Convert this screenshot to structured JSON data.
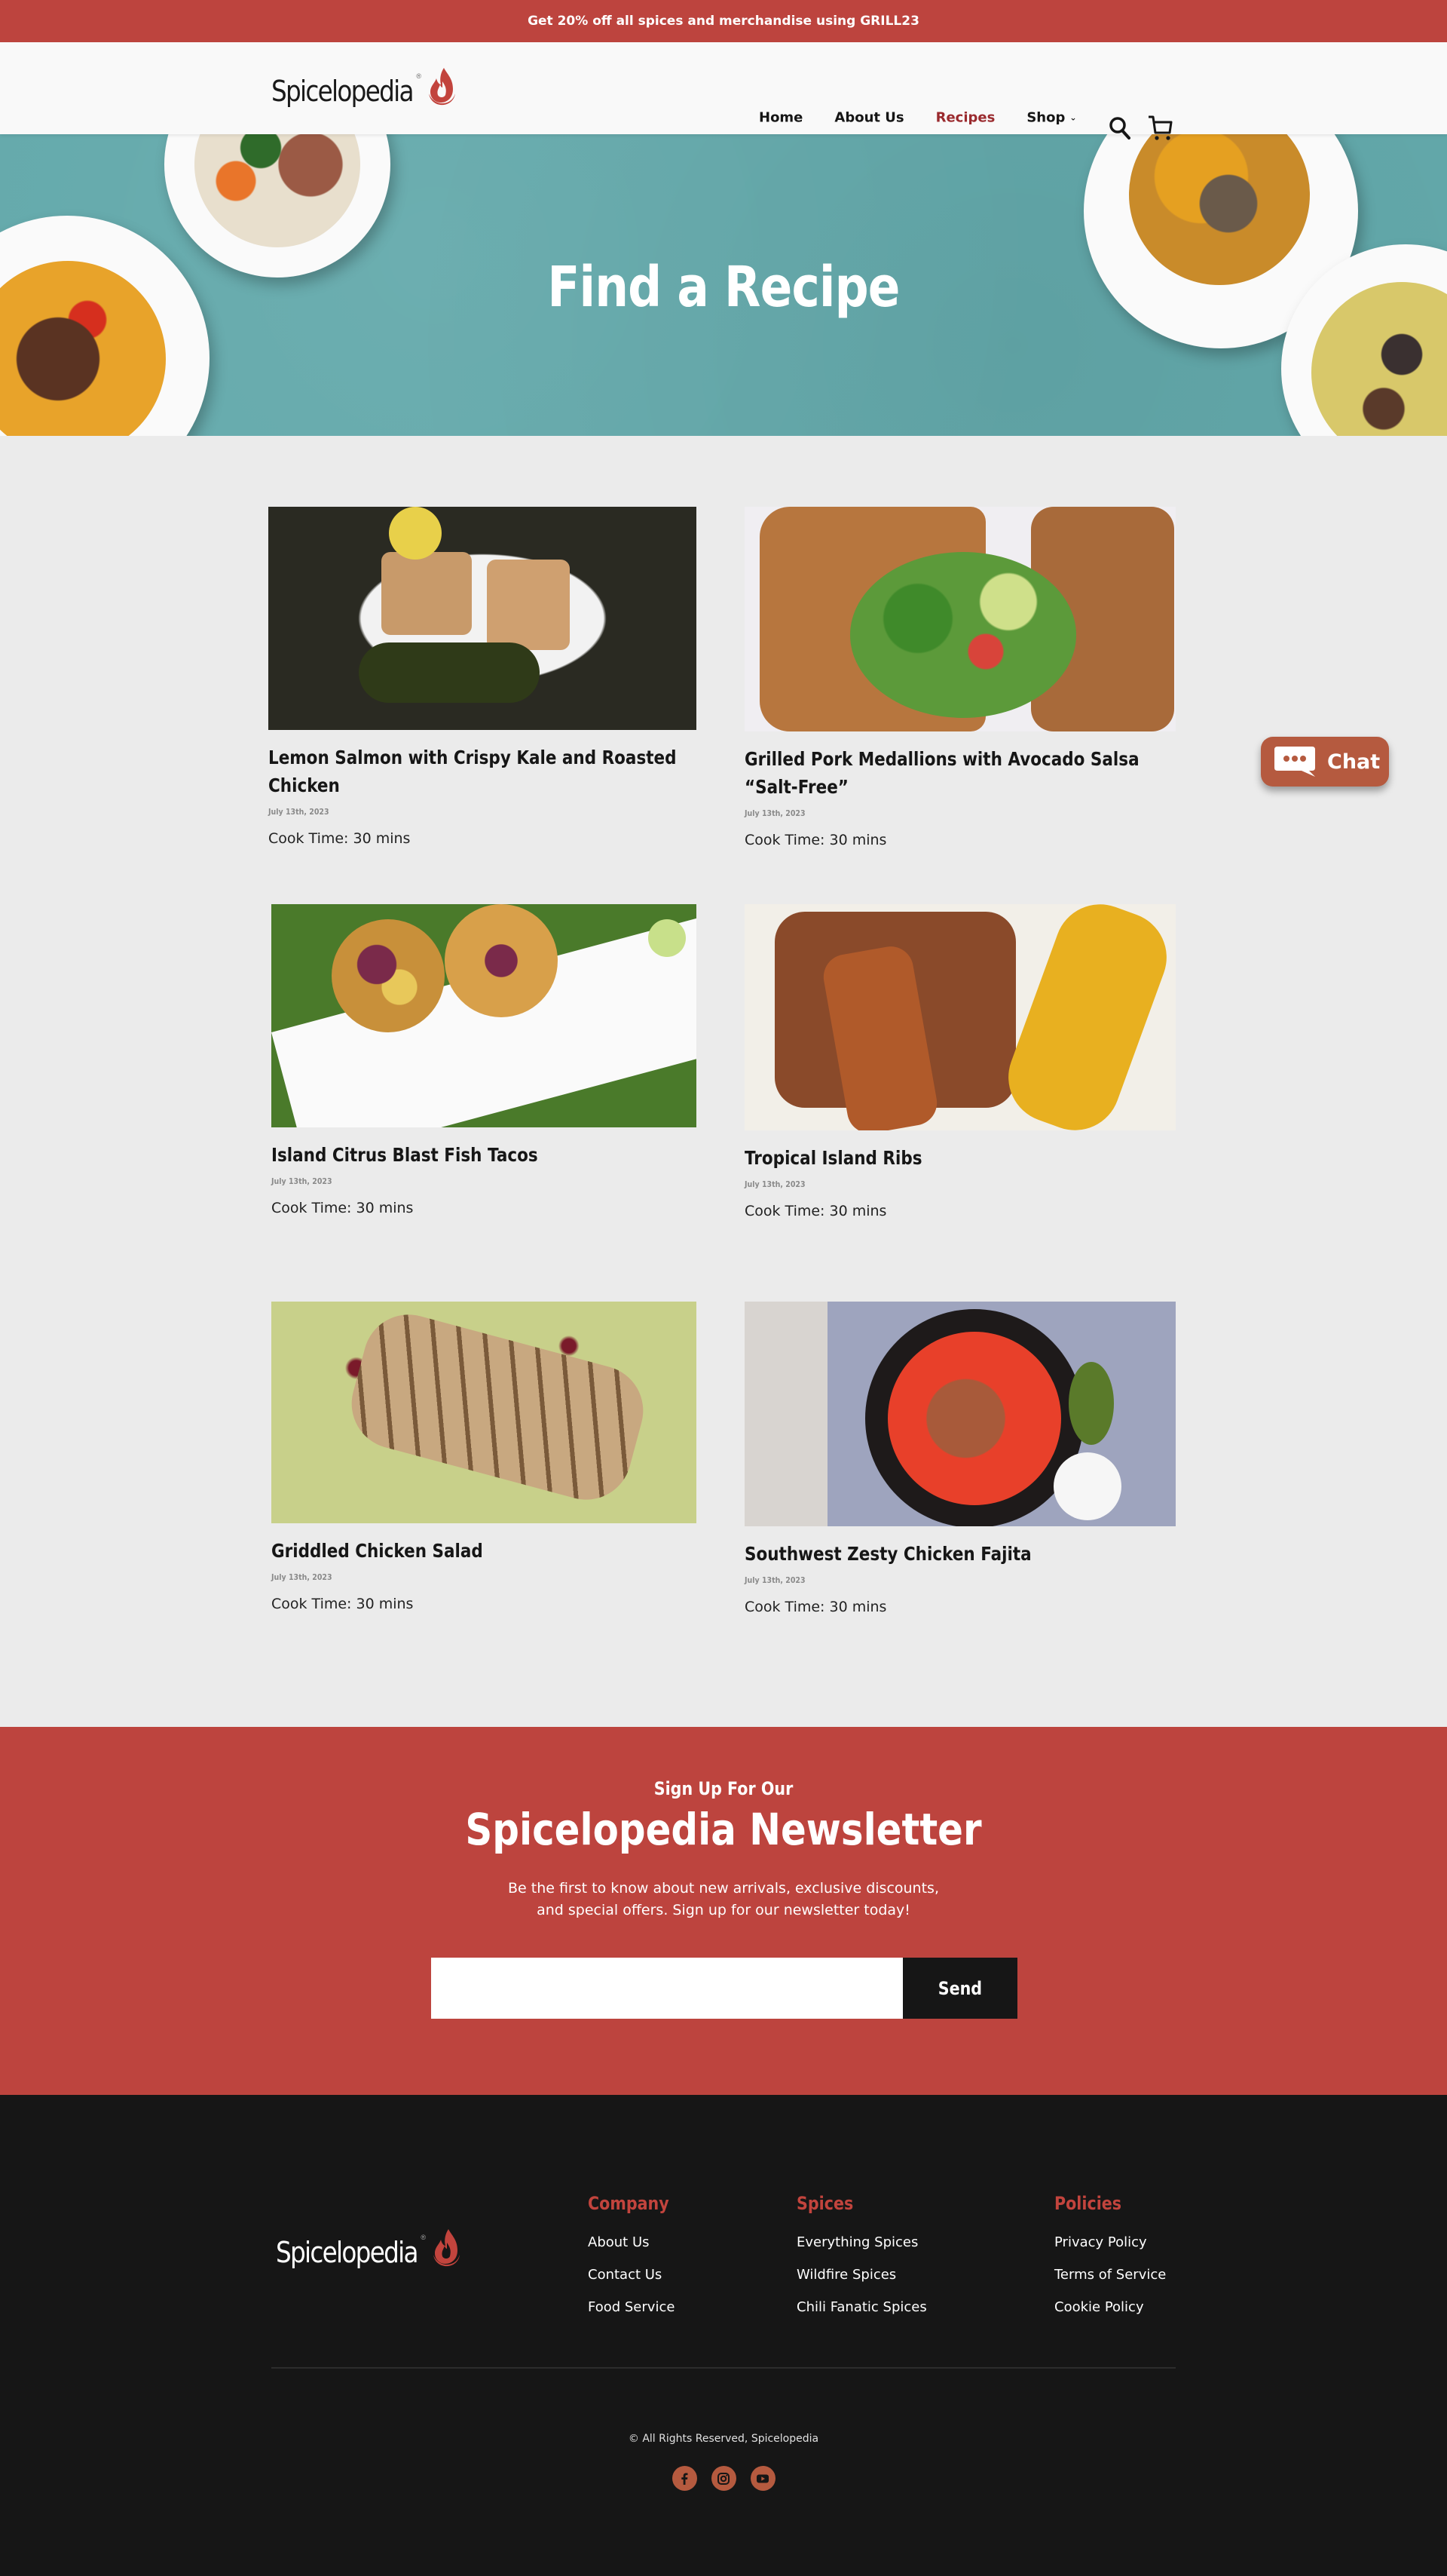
{
  "promo": {
    "text": "Get 20% off all spices and merchandise using GRILL23"
  },
  "header": {
    "logo_text": "Spicelopedia",
    "logo_mark": "®",
    "nav": [
      {
        "label": "Home",
        "active": false
      },
      {
        "label": "About Us",
        "active": false
      },
      {
        "label": "Recipes",
        "active": true
      },
      {
        "label": "Shop",
        "active": false,
        "has_dropdown": true
      }
    ],
    "icons": [
      "search-icon",
      "cart-icon"
    ]
  },
  "hero": {
    "title": "Find a Recipe"
  },
  "recipes": [
    {
      "title": "Lemon Salmon with Crispy Kale and Roasted Chicken",
      "date": "July 13th, 2023",
      "cook_time": "Cook Time: 30 mins",
      "image": "lemon salmon with kale and chickpeas"
    },
    {
      "title": "Grilled Pork Medallions with Avocado Salsa “Salt-Free”",
      "date": "July 13th, 2023",
      "cook_time": "Cook Time: 30 mins",
      "image": "grilled pork with avocado salsa"
    },
    {
      "title": "Island Citrus Blast Fish Tacos",
      "date": "July 13th, 2023",
      "cook_time": "Cook Time: 30 mins",
      "image": "fish tacos with lime"
    },
    {
      "title": "Tropical Island Ribs",
      "date": "July 13th, 2023",
      "cook_time": "Cook Time: 30 mins",
      "image": "ribs with grilled corn"
    },
    {
      "title": "Griddled Chicken Salad",
      "date": "July 13th, 2023",
      "cook_time": "Cook Time: 30 mins",
      "image": "chicken salad with pomegranate"
    },
    {
      "title": "Southwest Zesty Chicken Fajita",
      "date": "July 13th, 2023",
      "cook_time": "Cook Time: 30 mins",
      "image": "chicken fajita skillet"
    }
  ],
  "chat": {
    "label": "Chat"
  },
  "newsletter": {
    "kicker": "Sign Up For Our",
    "title": "Spicelopedia Newsletter",
    "description_line1": "Be the first to know about new arrivals, exclusive discounts,",
    "description_line2": "and special offers. Sign up for our newsletter today!",
    "input_value": "",
    "input_placeholder": "",
    "button_label": "Send"
  },
  "footer": {
    "logo_text": "Spicelopedia",
    "logo_mark": "®",
    "columns": [
      {
        "heading": "Company",
        "links": [
          "About Us",
          "Contact Us",
          "Food Service"
        ]
      },
      {
        "heading": "Spices",
        "links": [
          "Everything Spices",
          "Wildfire Spices",
          "Chili Fanatic Spices"
        ]
      },
      {
        "heading": "Policies",
        "links": [
          "Privacy Policy",
          "Terms of Service",
          "Cookie Policy"
        ]
      }
    ],
    "copyright": "© All Rights Reserved, Spicelopedia",
    "socials": [
      "facebook-icon",
      "instagram-icon",
      "youtube-icon"
    ]
  },
  "colors": {
    "brand_red": "#bd443e",
    "active_nav": "#9a2a2e",
    "hero_teal": "#63a9ab",
    "chat_orange": "#b55a3f",
    "footer_bg": "#161616",
    "page_bg": "#ebebeb"
  }
}
